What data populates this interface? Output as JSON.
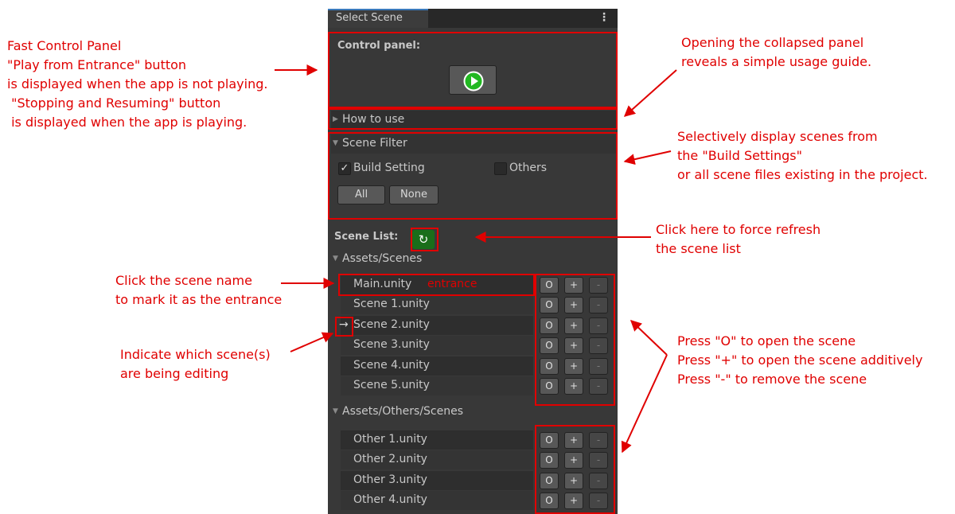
{
  "window": {
    "tab_title": "Select Scene",
    "menu_icon": "kebab-menu-icon"
  },
  "control_panel": {
    "label": "Control panel:",
    "play_icon": "play-icon"
  },
  "how_to_use": {
    "label": "How to use"
  },
  "scene_filter": {
    "label": "Scene Filter",
    "build_setting": {
      "label": "Build Setting",
      "checked": true
    },
    "others": {
      "label": "Others",
      "checked": false
    },
    "all_label": "All",
    "none_label": "None"
  },
  "scene_list": {
    "label": "Scene List:",
    "refresh_icon": "refresh-icon",
    "groups": [
      {
        "path": "Assets/Scenes",
        "scenes": [
          {
            "name": "Main.unity",
            "tag": "entrance"
          },
          {
            "name": "Scene 1.unity"
          },
          {
            "name": "Scene 2.unity",
            "editing": true
          },
          {
            "name": "Scene 3.unity"
          },
          {
            "name": "Scene 4.unity"
          },
          {
            "name": "Scene 5.unity"
          }
        ]
      },
      {
        "path": "Assets/Others/Scenes",
        "scenes": [
          {
            "name": "Other 1.unity"
          },
          {
            "name": "Other 2.unity"
          },
          {
            "name": "Other 3.unity"
          },
          {
            "name": "Other 4.unity"
          }
        ]
      }
    ],
    "open_label": "O",
    "additive_label": "+",
    "remove_label": "-",
    "editing_marker": "→"
  },
  "annotations": {
    "fast_control": [
      "Fast Control Panel",
      "\"Play from Entrance\" button",
      "is displayed when the app is not playing.",
      " \"Stopping and Resuming\" button",
      " is displayed when the app is playing."
    ],
    "collapsed_panel": [
      "Opening the collapsed panel",
      "reveals a simple usage guide."
    ],
    "filter": [
      "Selectively display scenes from",
      "the \"Build Settings\"",
      "or all scene files existing in the project."
    ],
    "refresh": [
      "Click here to force refresh",
      "the scene list"
    ],
    "entrance": [
      "Click the scene name",
      "to mark it as the entrance"
    ],
    "editing": [
      "Indicate which scene(s)",
      "are being editing"
    ],
    "buttons": [
      "Press \"O\" to open the scene",
      "Press \"+\" to open the scene additively",
      "Press \"-\" to remove the scene"
    ]
  },
  "colors": {
    "annotation": "#e00000",
    "panel_bg": "#383838",
    "play_green": "#22b822",
    "refresh_green": "#1a6e1a"
  }
}
